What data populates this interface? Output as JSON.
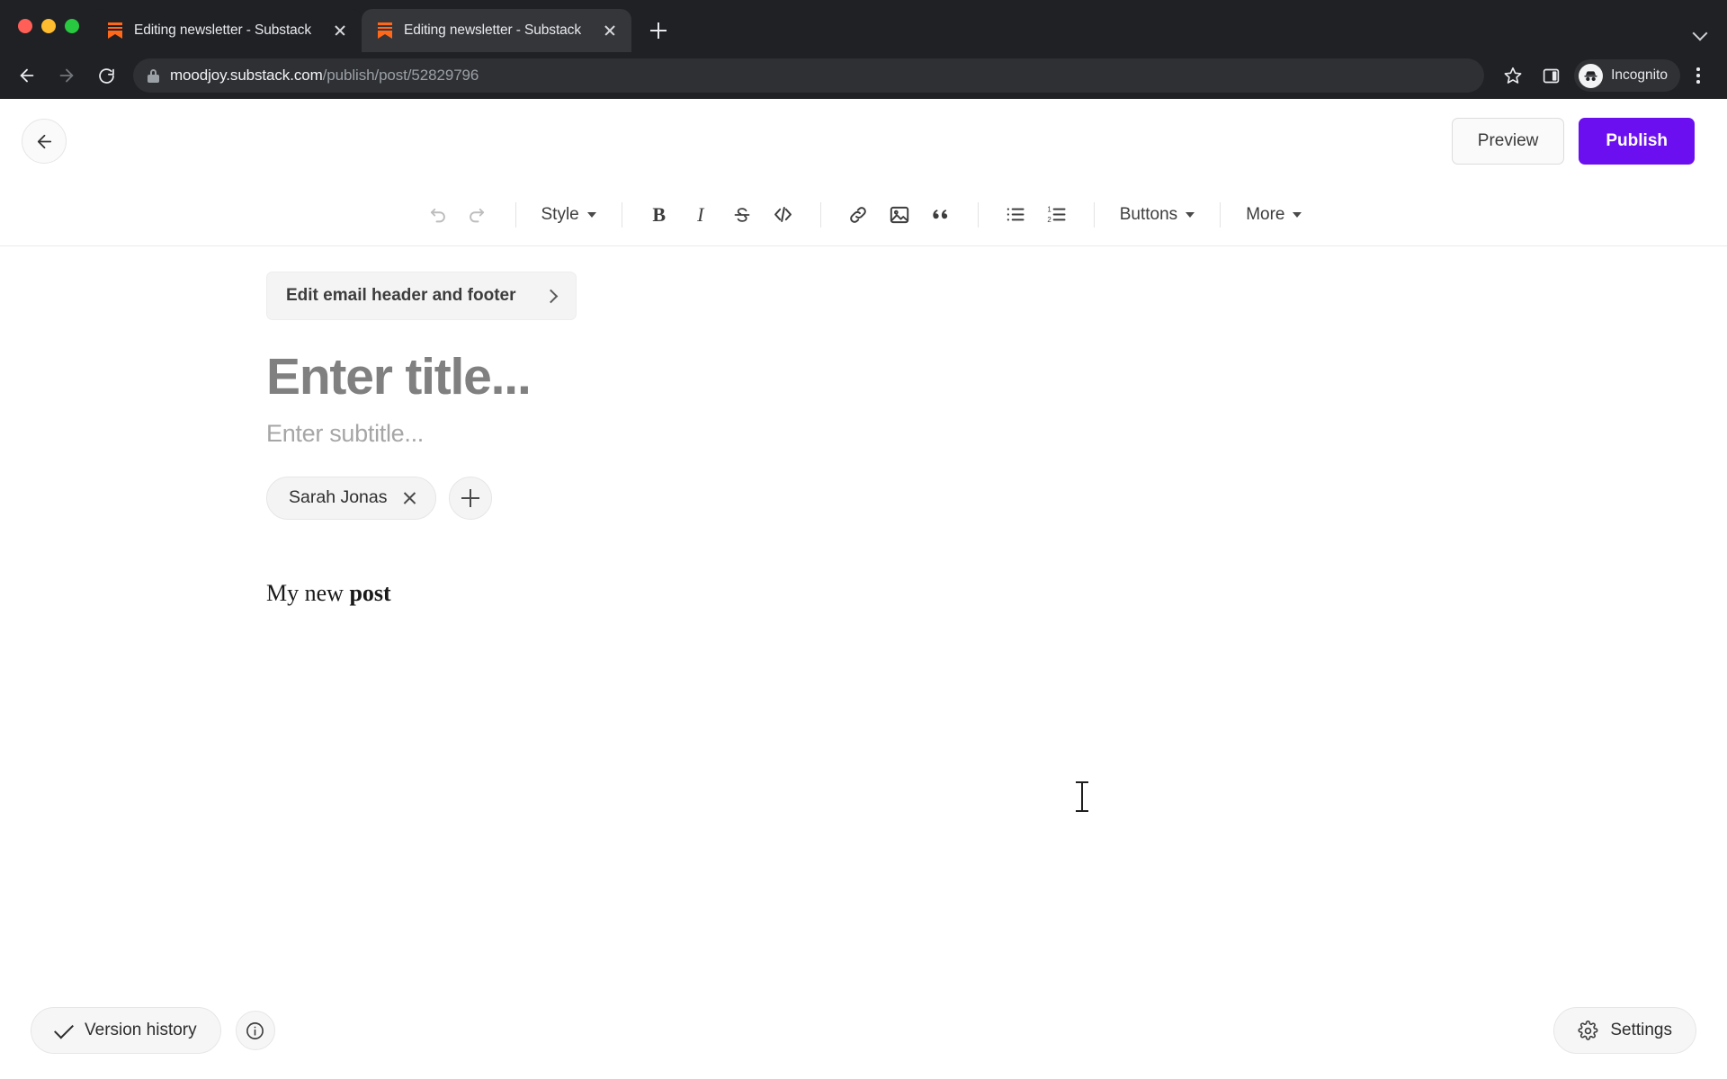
{
  "browser": {
    "tabs": [
      {
        "title": "Editing newsletter - Substack",
        "favicon": "substack-bookmark-icon",
        "active": false
      },
      {
        "title": "Editing newsletter - Substack",
        "favicon": "substack-bookmark-icon",
        "active": true
      }
    ],
    "new_tab_label": "+",
    "address": {
      "domain": "moodjoy.substack.com",
      "path": "/publish/post/52829796",
      "secure_icon": "lock-icon"
    },
    "profile": {
      "label": "Incognito",
      "icon": "incognito-icon"
    },
    "icons": {
      "back": "back-arrow-icon",
      "forward": "forward-arrow-icon",
      "reload": "reload-icon",
      "bookmark": "star-icon",
      "side_panel": "side-panel-icon",
      "menu": "kebab-menu-icon",
      "tab_list": "chevron-down-icon"
    }
  },
  "app": {
    "header": {
      "back_icon": "back-arrow-icon",
      "preview_label": "Preview",
      "publish_label": "Publish",
      "publish_color": "#6B0FF0"
    },
    "toolbar": {
      "undo_icon": "undo-icon",
      "redo_icon": "redo-icon",
      "style_label": "Style",
      "bold_label": "B",
      "italic_label": "I",
      "strikethrough_label": "S",
      "code_icon": "code-icon",
      "link_icon": "link-icon",
      "image_icon": "image-icon",
      "quote_icon": "quote-icon",
      "bullet_list_icon": "bullet-list-icon",
      "numbered_list_icon": "numbered-list-icon",
      "buttons_label": "Buttons",
      "more_label": "More"
    },
    "editor": {
      "email_header_footer_label": "Edit email header and footer",
      "title_placeholder": "Enter title...",
      "subtitle_placeholder": "Enter subtitle...",
      "authors": [
        {
          "name": "Sarah Jonas",
          "remove_icon": "close-icon"
        }
      ],
      "add_author_icon": "plus-icon",
      "body": {
        "text_regular": "My new ",
        "text_bold": "post"
      }
    },
    "bottom": {
      "version_history_label": "Version history",
      "version_history_icon": "check-icon",
      "info_icon": "info-icon",
      "settings_label": "Settings",
      "settings_icon": "gear-icon"
    }
  }
}
